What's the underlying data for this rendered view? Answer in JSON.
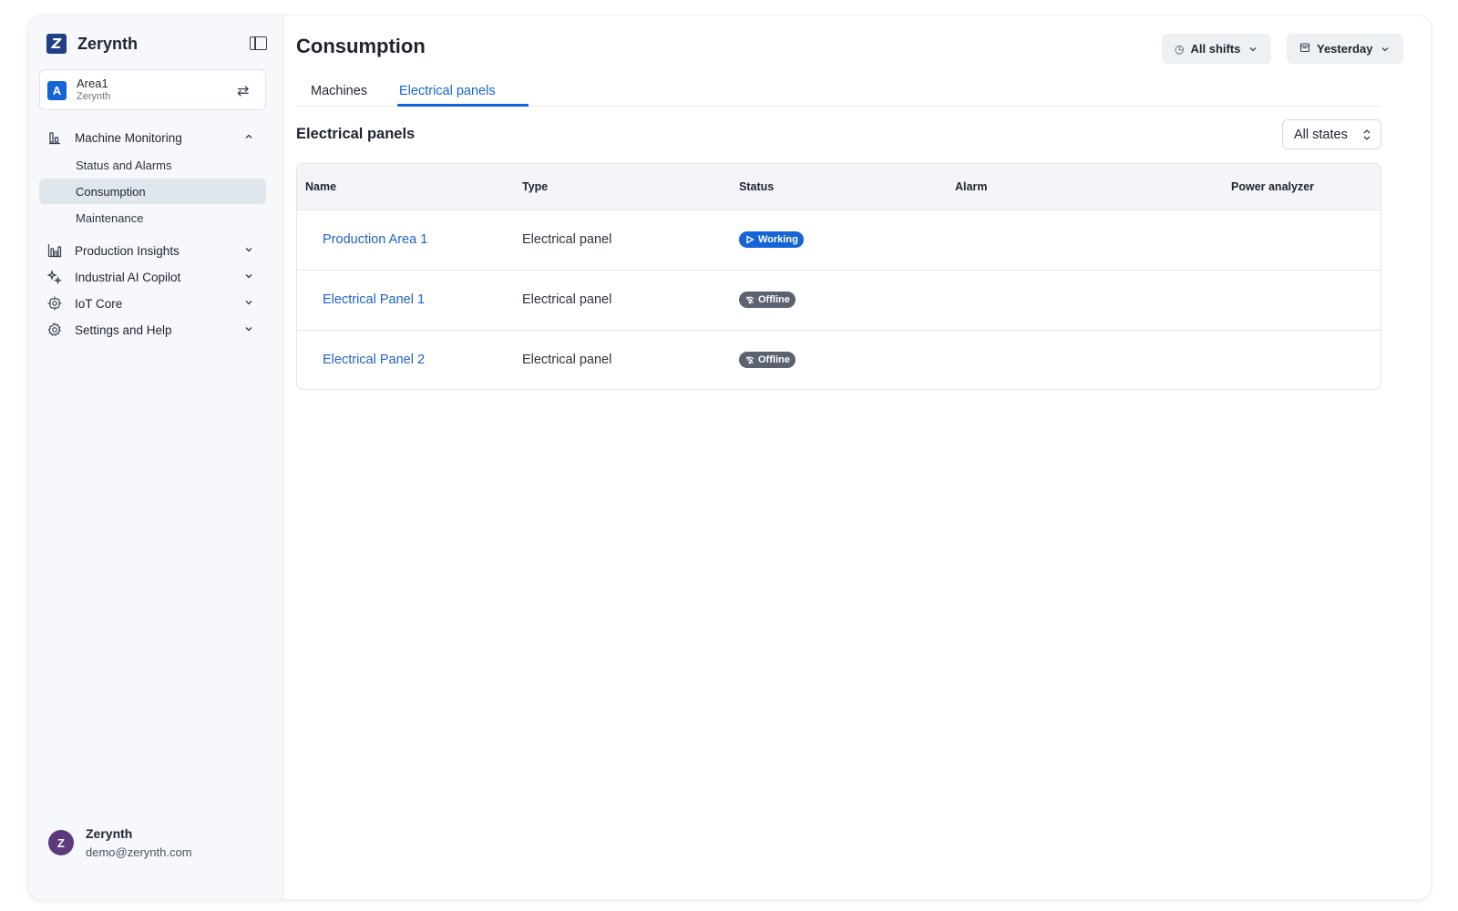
{
  "brand": {
    "name": "Zerynth",
    "logo_letter": "Z"
  },
  "area": {
    "avatar": "A",
    "name": "Area1",
    "org": "Zerynth"
  },
  "nav": {
    "machine_monitoring": {
      "label": "Machine Monitoring",
      "items": [
        {
          "label": "Status and Alarms"
        },
        {
          "label": "Consumption"
        },
        {
          "label": "Maintenance"
        }
      ]
    },
    "production_insights": {
      "label": "Production Insights"
    },
    "industrial_ai": {
      "label": "Industrial AI Copilot"
    },
    "iot_core": {
      "label": "IoT Core"
    },
    "settings_help": {
      "label": "Settings and Help"
    }
  },
  "user": {
    "avatar": "Z",
    "name": "Zerynth",
    "email": "demo@zerynth.com"
  },
  "page": {
    "title": "Consumption"
  },
  "filters": {
    "shifts": "All shifts",
    "date": "Yesterday"
  },
  "tabs": [
    {
      "label": "Machines"
    },
    {
      "label": "Electrical panels"
    }
  ],
  "section": {
    "title": "Electrical panels",
    "state_filter": "All states"
  },
  "table": {
    "columns": [
      "Name",
      "Type",
      "Status",
      "Alarm",
      "Power analyzer"
    ],
    "rows": [
      {
        "name": "Production Area 1",
        "type": "Electrical panel",
        "status": "Working",
        "alarm": "",
        "power_analyzer": ""
      },
      {
        "name": "Electrical Panel 1",
        "type": "Electrical panel",
        "status": "Offline",
        "alarm": "",
        "power_analyzer": ""
      },
      {
        "name": "Electrical Panel 2",
        "type": "Electrical panel",
        "status": "Offline",
        "alarm": "",
        "power_analyzer": ""
      }
    ]
  },
  "colors": {
    "accent": "#1565d8",
    "status_working": "#1565d8",
    "status_offline": "#5b6270",
    "sidebar_active": "#dfe6ee"
  },
  "icons": {
    "working": "play-icon",
    "offline": "wifi-off-icon"
  }
}
